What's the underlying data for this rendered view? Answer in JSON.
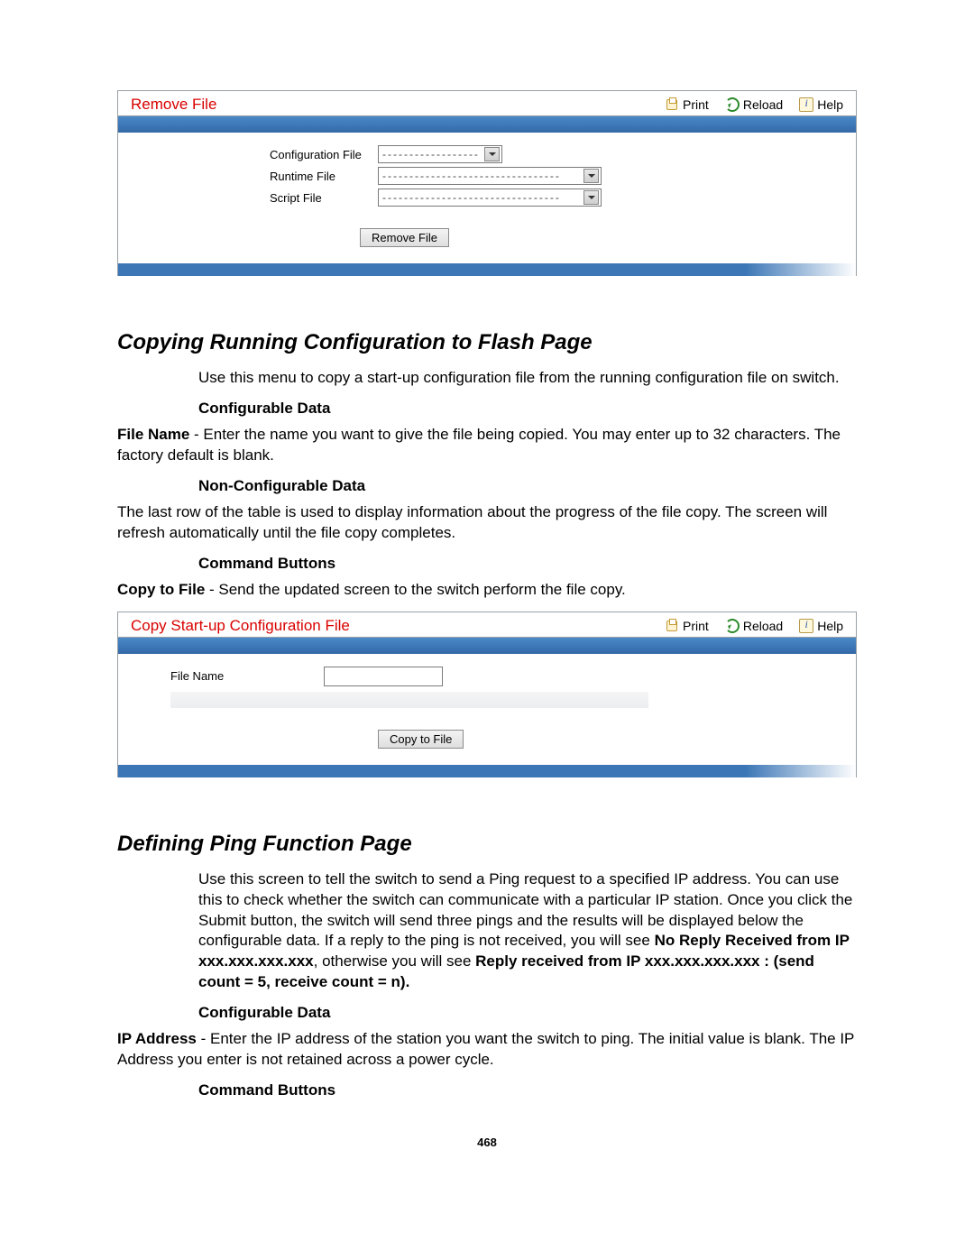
{
  "panel_remove": {
    "title": "Remove File",
    "actions": {
      "print": "Print",
      "reload": "Reload",
      "help": "Help"
    },
    "labels": {
      "config_file": "Configuration File",
      "runtime_file": "Runtime File",
      "script_file": "Script File"
    },
    "select_placeholder_short": "------------------",
    "select_placeholder_long": "---------------------------------",
    "button": "Remove File"
  },
  "section_copy": {
    "heading": "Copying Running Configuration to Flash Page",
    "intro": "Use this menu to copy a start-up configuration file from the running configuration file on switch.",
    "h4a": "Configurable Data",
    "p1_prefix": "File Name",
    "p1_rest": " - Enter the name you want to give the file being copied. You may enter up to 32 characters. The factory default is blank.",
    "h4b": "Non-Configurable Data",
    "p2": "The last row of the table is used to display information about the progress of the file copy. The screen will refresh automatically until the file copy completes.",
    "h4c": "Command Buttons",
    "p3_prefix": "Copy to File",
    "p3_rest": " - Send the updated screen to the switch perform the file copy."
  },
  "panel_copy": {
    "title": "Copy Start-up Configuration File",
    "actions": {
      "print": "Print",
      "reload": "Reload",
      "help": "Help"
    },
    "label_filename": "File Name",
    "button": "Copy to File"
  },
  "section_ping": {
    "heading": "Defining Ping Function Page",
    "intro_a": "Use this screen to tell the switch to send a Ping request to a specified IP address. You can use this to check whether the switch can communicate with a particular IP station. Once you click the Submit button, the switch will send three pings and the results will be displayed below the configurable data. If a reply to the ping is not received, you will see ",
    "intro_bold1": "No Reply Received from IP xxx.xxx.xxx.xxx",
    "intro_b": ", otherwise you will see ",
    "intro_bold2": "Reply received from IP xxx.xxx.xxx.xxx : (send count = 5, receive count = n).",
    "h4a": "Configurable Data",
    "p1_prefix": "IP Address",
    "p1_rest": " - Enter the IP address of the station you want the switch to ping. The initial value is blank. The IP Address you enter is not retained across a power cycle.",
    "h4b": "Command Buttons"
  },
  "page_number": "468"
}
